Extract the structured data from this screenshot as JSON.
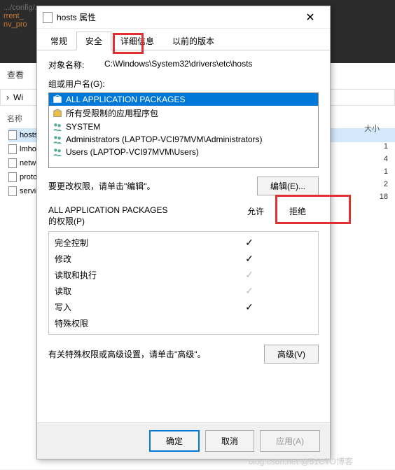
{
  "background": {
    "code_fragments": [
      "rrent_",
      "nv_pro"
    ],
    "explorer": {
      "search_label": "查看",
      "path_parts": [
        "",
        "Wi"
      ],
      "name_col": "名称",
      "size_col": "大小",
      "files": [
        {
          "name": "hosts",
          "size": "1"
        },
        {
          "name": "lmhosts",
          "size": "4"
        },
        {
          "name": "netwo",
          "size": "1"
        },
        {
          "name": "proto",
          "size": "2"
        },
        {
          "name": "servic",
          "size": "18"
        }
      ]
    }
  },
  "dialog": {
    "title": "hosts 属性",
    "tabs": [
      {
        "label": "常规"
      },
      {
        "label": "安全",
        "active": true
      },
      {
        "label": "详细信息"
      },
      {
        "label": "以前的版本"
      }
    ],
    "object_label": "对象名称:",
    "object_value": "C:\\Windows\\System32\\drivers\\etc\\hosts",
    "groups_label": "组或用户名(G):",
    "groups": [
      {
        "name": "ALL APPLICATION PACKAGES",
        "selected": true,
        "icon": "package"
      },
      {
        "name": "所有受限制的应用程序包",
        "icon": "package"
      },
      {
        "name": "SYSTEM",
        "icon": "users"
      },
      {
        "name": "Administrators (LAPTOP-VCI97MVM\\Administrators)",
        "icon": "users"
      },
      {
        "name": "Users (LAPTOP-VCI97MVM\\Users)",
        "icon": "users"
      }
    ],
    "edit_hint": "要更改权限，请单击\"编辑\"。",
    "edit_button": "编辑(E)...",
    "perm_title_prefix": "ALL APPLICATION PACKAGES",
    "perm_title_suffix": "的权限(P)",
    "perm_allow": "允许",
    "perm_deny": "拒绝",
    "permissions": [
      {
        "name": "完全控制",
        "allow": true,
        "dim": false
      },
      {
        "name": "修改",
        "allow": true,
        "dim": false
      },
      {
        "name": "读取和执行",
        "allow": true,
        "dim": true
      },
      {
        "name": "读取",
        "allow": true,
        "dim": true
      },
      {
        "name": "写入",
        "allow": true,
        "dim": false
      },
      {
        "name": "特殊权限",
        "allow": false,
        "dim": false
      }
    ],
    "advanced_hint": "有关特殊权限或高级设置，请单击\"高级\"。",
    "advanced_button": "高级(V)",
    "ok": "确定",
    "cancel": "取消",
    "apply": "应用(A)"
  },
  "watermark": "blog.csdn.net @51CTO博客"
}
